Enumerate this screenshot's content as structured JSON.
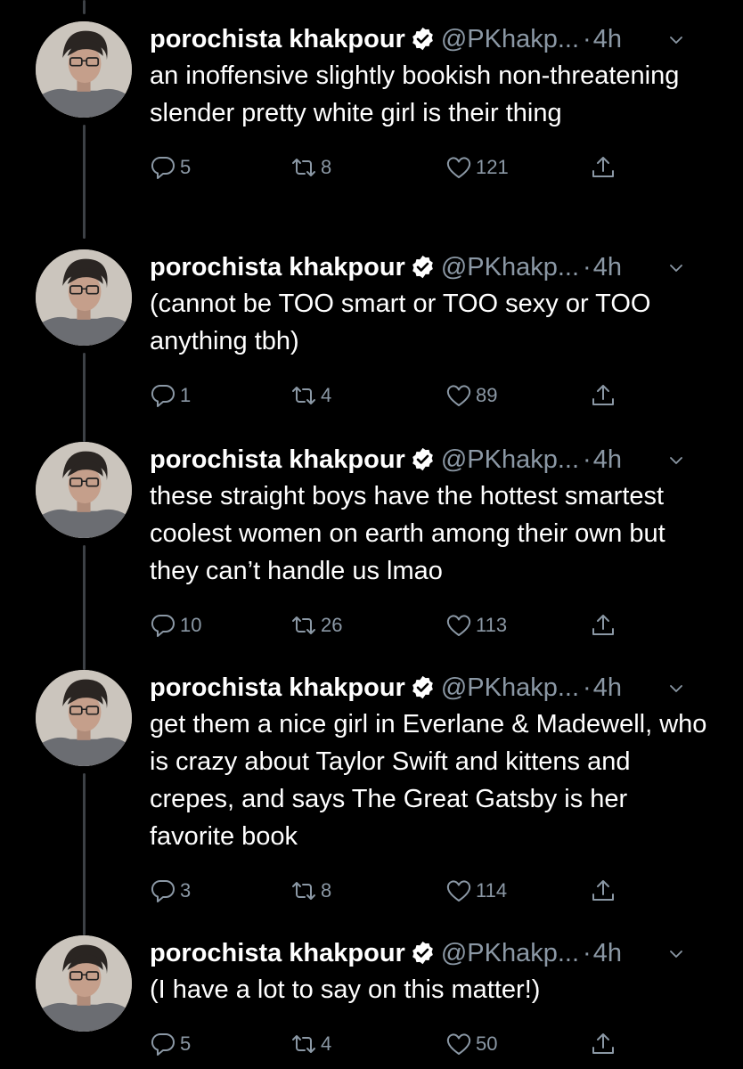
{
  "colors": {
    "background": "#000000",
    "text": "#ffffff",
    "muted": "#8b98a5",
    "verified": "#ffffff"
  },
  "tweets": [
    {
      "name": "porochista khakpour",
      "handle": "@PKhakp...",
      "time": "4h",
      "text": "an inoffensive slightly bookish non-threatening slender pretty white girl is their thing",
      "replies": "5",
      "retweets": "8",
      "likes": "121"
    },
    {
      "name": "porochista khakpour",
      "handle": "@PKhakp...",
      "time": "4h",
      "text": "(cannot be TOO smart or TOO sexy or TOO anything tbh)",
      "replies": "1",
      "retweets": "4",
      "likes": "89"
    },
    {
      "name": "porochista khakpour",
      "handle": "@PKhakp...",
      "time": "4h",
      "text": "these straight boys have the hottest smartest coolest women on earth among their own but they can’t handle us lmao",
      "replies": "10",
      "retweets": "26",
      "likes": "113"
    },
    {
      "name": "porochista khakpour",
      "handle": "@PKhakp...",
      "time": "4h",
      "text": "get them a nice girl in Everlane & Madewell, who is crazy about Taylor Swift and kittens and crepes, and says The Great Gatsby is her favorite book",
      "replies": "3",
      "retweets": "8",
      "likes": "114"
    },
    {
      "name": "porochista khakpour",
      "handle": "@PKhakp...",
      "time": "4h",
      "text": "(I have a lot to say on this matter!)",
      "replies": "5",
      "retweets": "4",
      "likes": "50"
    }
  ]
}
